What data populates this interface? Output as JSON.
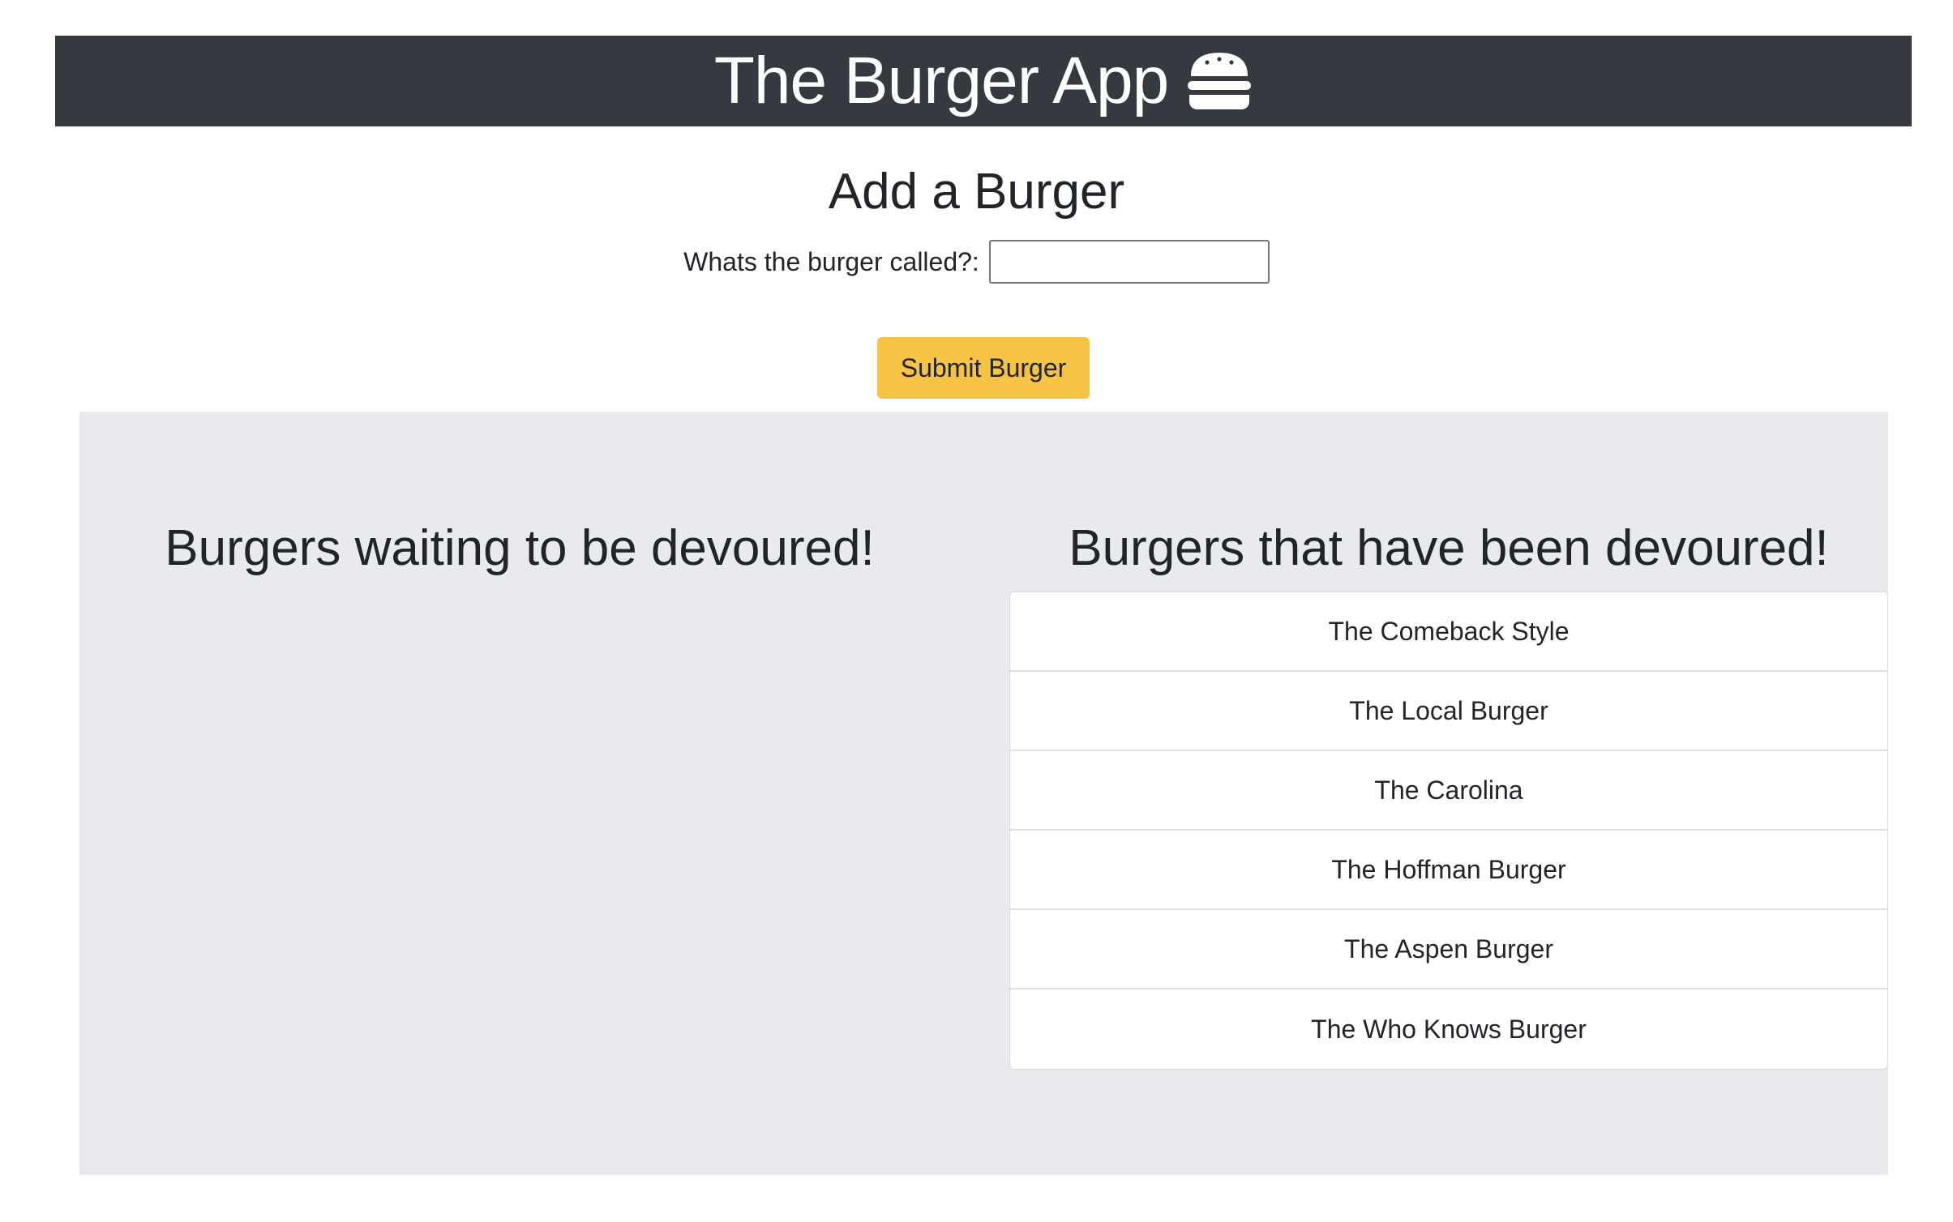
{
  "header": {
    "title": "The Burger App",
    "icon": "hamburger-icon"
  },
  "form": {
    "title": "Add a Burger",
    "label": "Whats the burger called?:",
    "input_value": "",
    "input_placeholder": "",
    "submit_label": "Submit Burger"
  },
  "columns": {
    "waiting_heading": "Burgers waiting to be devoured!",
    "devoured_heading": "Burgers that have been devoured!",
    "waiting": [],
    "devoured": [
      "The Comeback Style",
      "The Local Burger",
      "The Carolina",
      "The Hoffman Burger",
      "The Aspen Burger",
      "The Who Knows Burger"
    ]
  },
  "colors": {
    "header_bg": "#343a40",
    "button_bg": "#f6c344",
    "panel_bg": "#e9eaee"
  }
}
